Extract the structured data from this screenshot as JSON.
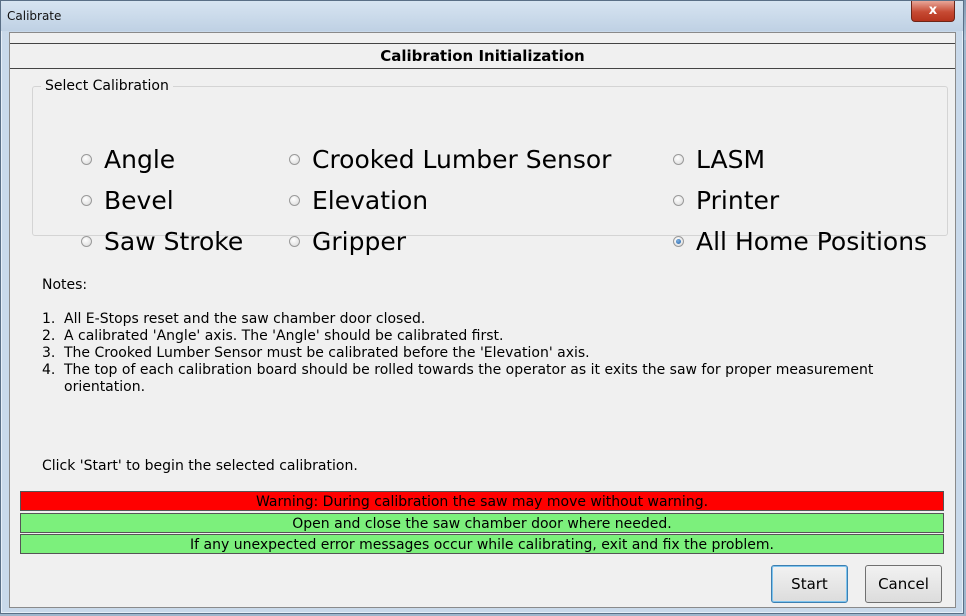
{
  "window": {
    "title": "Calibrate",
    "close_label": "x"
  },
  "header": {
    "title": "Calibration Initialization"
  },
  "calibration_group": {
    "legend": "Select Calibration",
    "options": [
      {
        "label": "Angle",
        "checked": false
      },
      {
        "label": "Crooked Lumber Sensor",
        "checked": false
      },
      {
        "label": "LASM",
        "checked": false
      },
      {
        "label": "Bevel",
        "checked": false
      },
      {
        "label": "Elevation",
        "checked": false
      },
      {
        "label": "Printer",
        "checked": false
      },
      {
        "label": "Saw Stroke",
        "checked": false
      },
      {
        "label": "Gripper",
        "checked": false
      },
      {
        "label": "All Home Positions",
        "checked": true
      }
    ]
  },
  "notes": {
    "title": "Notes:",
    "items": [
      {
        "num": "1.",
        "text": "All E-Stops reset and the saw chamber door closed."
      },
      {
        "num": "2.",
        "text": "A calibrated 'Angle' axis.  The 'Angle' should be calibrated first."
      },
      {
        "num": "3.",
        "text": "The Crooked Lumber Sensor must be calibrated before the 'Elevation' axis."
      },
      {
        "num": "4.",
        "text": "The top of each calibration board should be rolled towards the operator as it exits the saw for proper measurement orientation."
      }
    ]
  },
  "instruction": "Click 'Start' to begin the selected calibration.",
  "banners": {
    "warning": "Warning: During calibration the saw may move without warning.",
    "info1": "Open and close the saw chamber door where needed.",
    "info2": "If any unexpected error messages occur while calibrating, exit and fix the problem."
  },
  "colors": {
    "warning_bg": "#ff0000",
    "info_bg": "#7cf07c"
  },
  "buttons": {
    "start": "Start",
    "cancel": "Cancel"
  }
}
